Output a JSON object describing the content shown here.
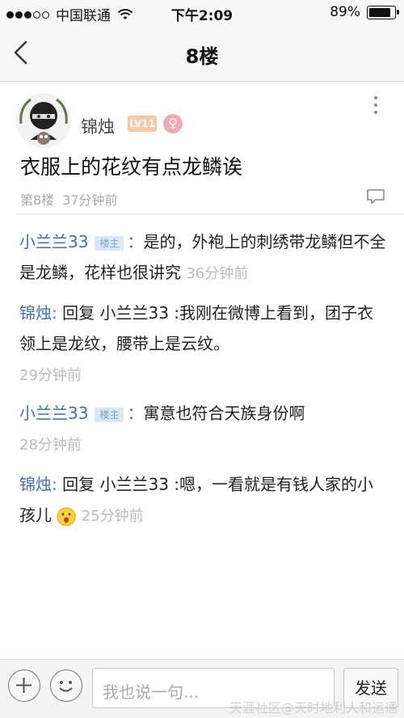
{
  "status_bar": {
    "carrier": "中国联通",
    "time": "下午2:09",
    "battery": "89%",
    "battery_level": 0.89,
    "signal_bars": 3
  },
  "nav": {
    "title": "8楼"
  },
  "post": {
    "author": "锦烛",
    "level": "LV11",
    "gender": "♀",
    "content": "衣服上的花纹有点龙鳞诶",
    "floor": "第8楼",
    "time": "37分钟前"
  },
  "replies": [
    {
      "name": "小兰兰33",
      "badge": "楼主",
      "separator": "：",
      "text": "是的，外袍上的刺绣带龙鳞但不全是龙鳞，花样也很讲究",
      "time": "36分钟前"
    },
    {
      "name": "锦烛",
      "separator": ": ",
      "text": "回复 小兰兰33 :我刚在微博上看到，团子衣领上是龙纹，腰带上是云纹。",
      "time": "29分钟前"
    },
    {
      "name": "小兰兰33",
      "badge": "楼主",
      "separator": "：",
      "text": "寓意也符合天族身份啊",
      "time": "28分钟前"
    },
    {
      "name": "锦烛",
      "separator": ": ",
      "text": "回复 小兰兰33 :嗯，一看就是有钱人家的小孩儿",
      "time": "25分钟前"
    }
  ],
  "bottom_bar": {
    "placeholder": "我也说一句...",
    "send_label": "发送"
  },
  "watermark": "天涯社区@天时地利人和运通",
  "colors": {
    "username_link": "#3f71b3",
    "badge_bg": "#d8e8f6",
    "level_bg": "#f5c9a2",
    "gender_bg": "#f3a8b6"
  }
}
